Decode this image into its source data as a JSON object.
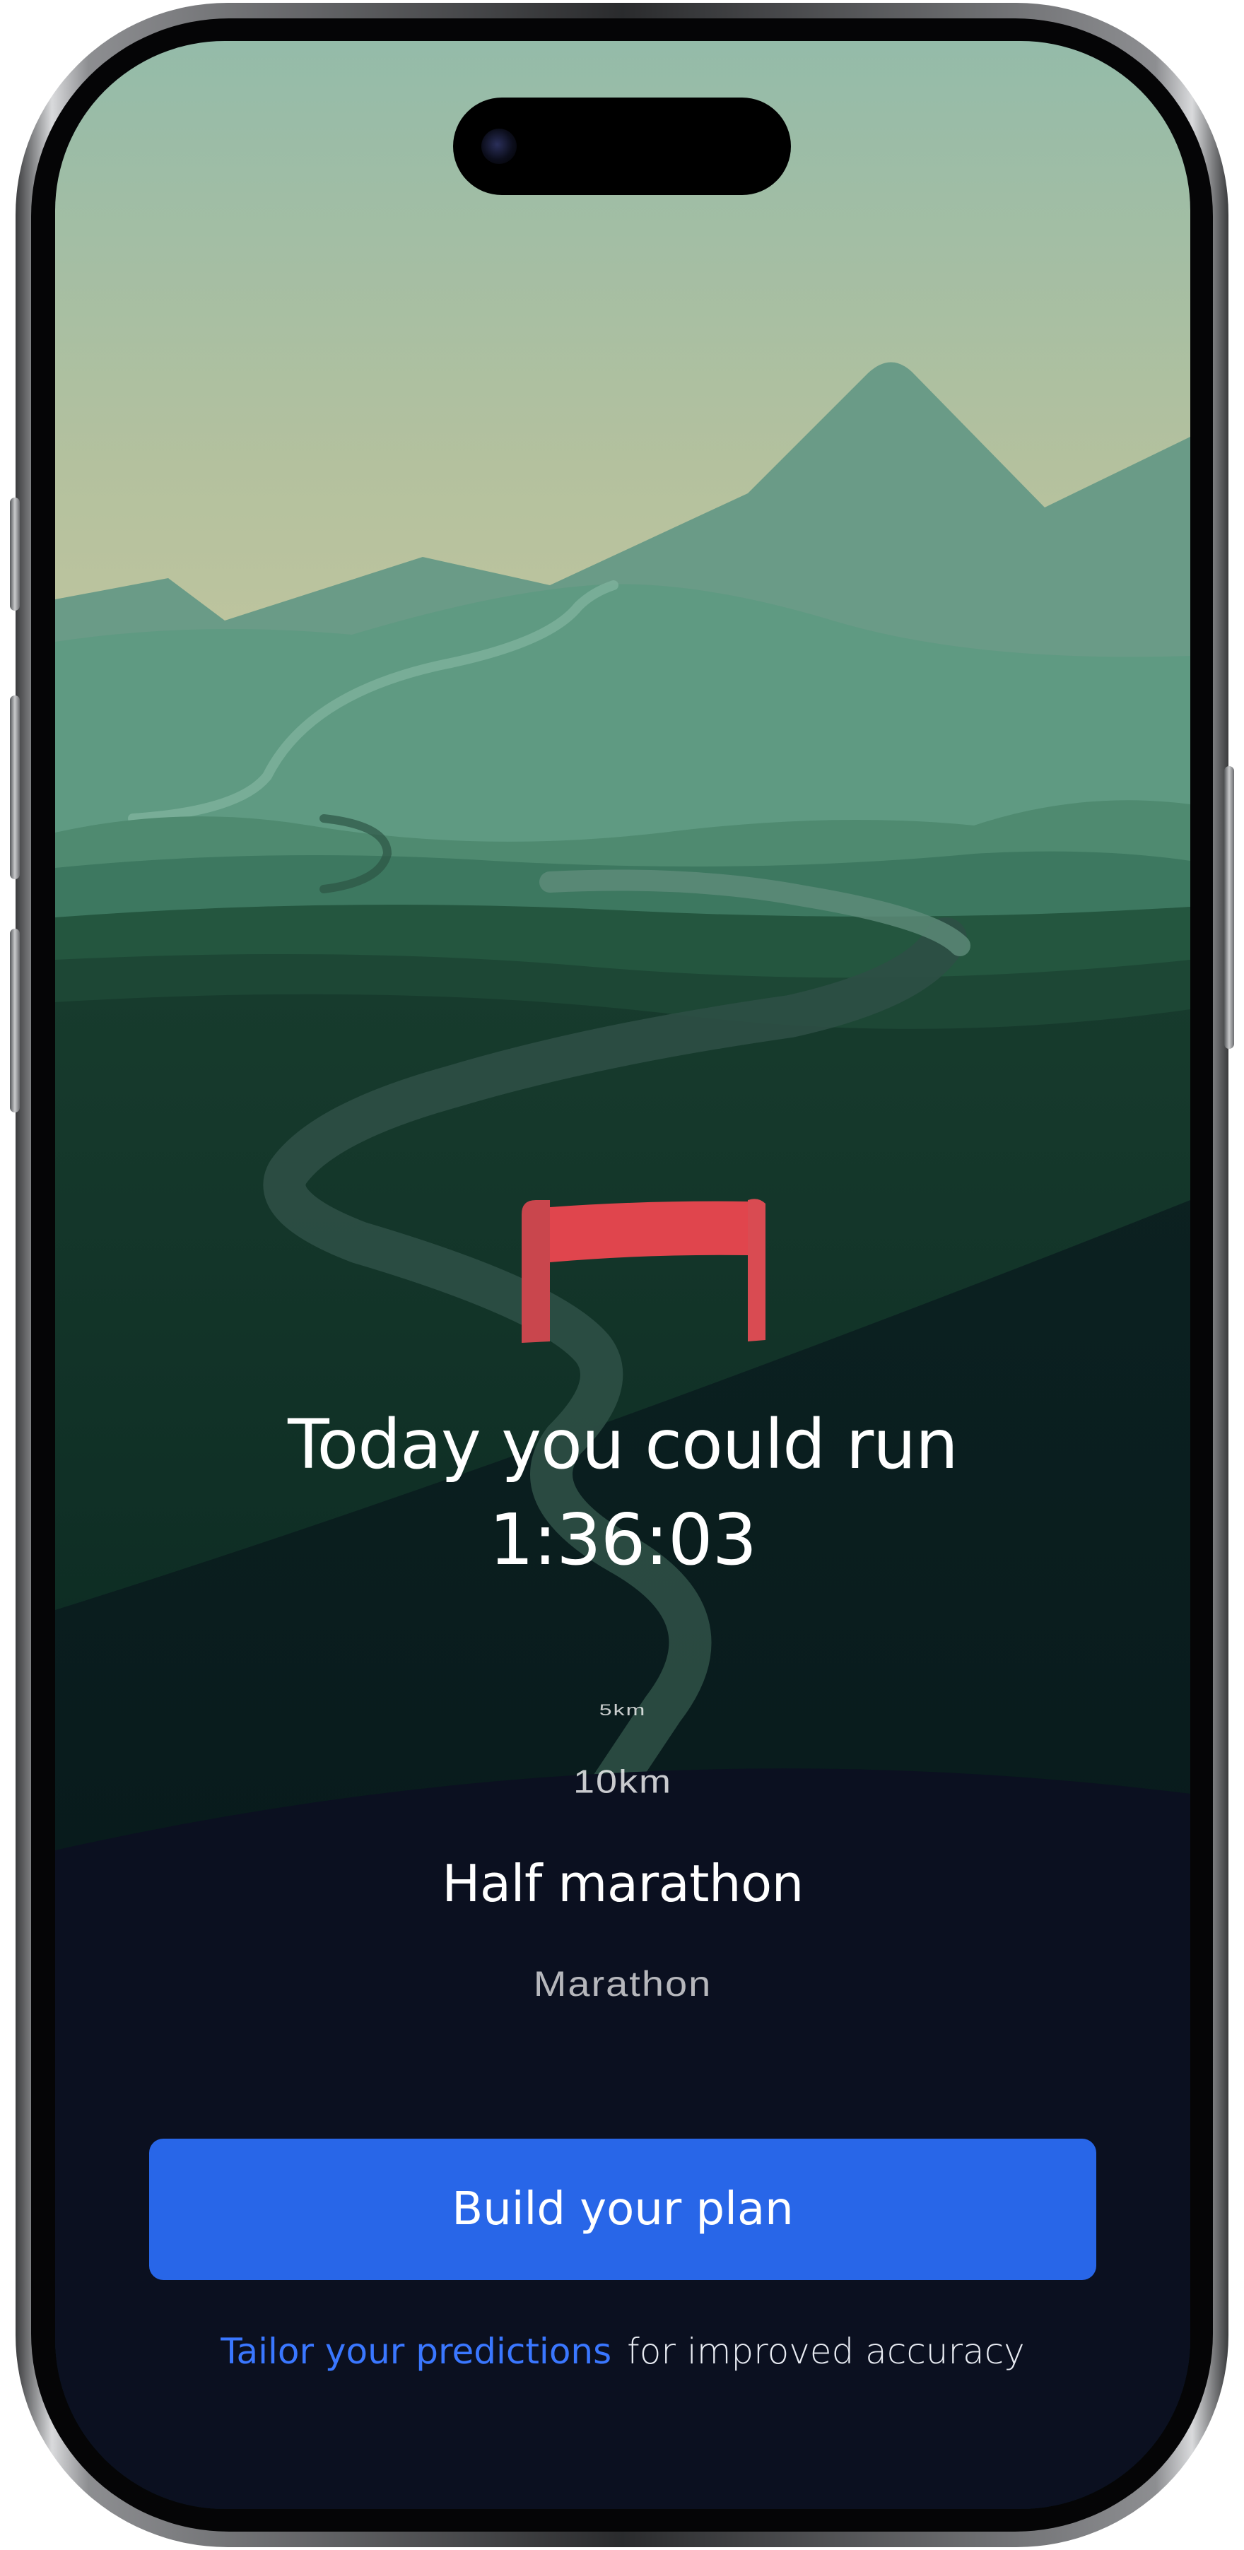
{
  "prediction": {
    "heading": "Today you could run",
    "time": "1:36:03"
  },
  "distance_picker": {
    "options": [
      "5km",
      "10km",
      "Half marathon",
      "Marathon"
    ],
    "selected": "Half marathon"
  },
  "cta": {
    "label": "Build your plan"
  },
  "footer": {
    "link_text": "Tailor your predictions",
    "rest_text": "for improved accuracy"
  },
  "colors": {
    "primary_button": "#2866e8",
    "link": "#3a77ff",
    "finish_banner": "#e0454d",
    "background_dark": "#0b1020"
  },
  "icons": {
    "illustration": "mountain-landscape-illustration",
    "finish": "finish-line-icon"
  }
}
